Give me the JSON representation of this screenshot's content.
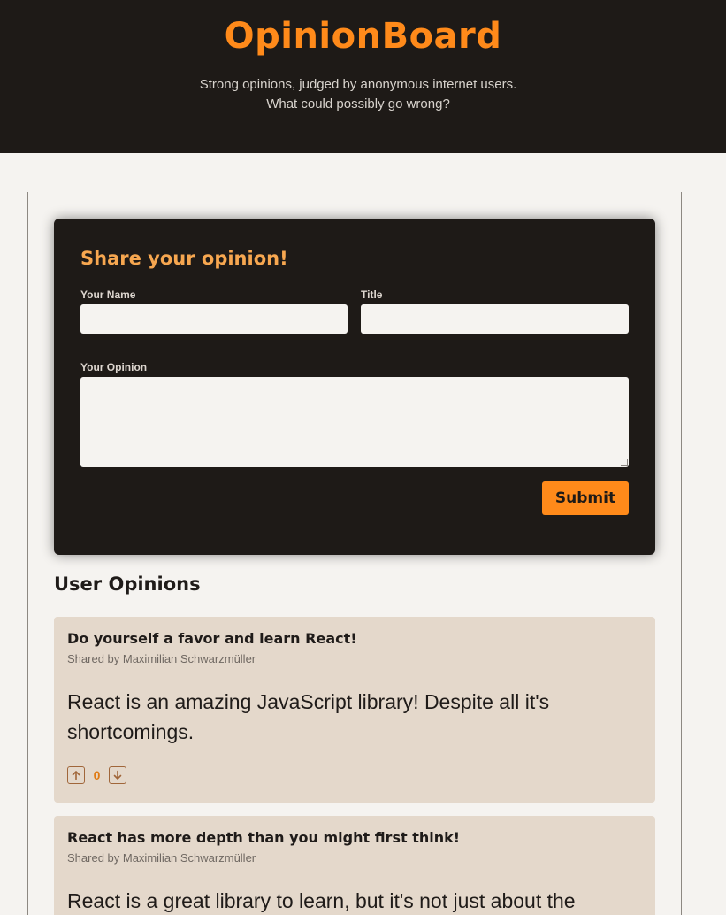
{
  "header": {
    "brand": "OpinionBoard",
    "tagline": "Strong opinions, judged by anonymous internet users. What could possibly go wrong?"
  },
  "form": {
    "heading": "Share your opinion!",
    "name_label": "Your Name",
    "name_value": "",
    "title_label": "Title",
    "title_value": "",
    "opinion_label": "Your Opinion",
    "opinion_value": "",
    "submit_label": "Submit"
  },
  "opinions_section": {
    "title": "User Opinions",
    "items": [
      {
        "title": "Do yourself a favor and learn React!",
        "author": "Shared by Maximilian Schwarzmüller",
        "body": "React is an amazing JavaScript library! Despite all it's shortcomings.",
        "votes": "0",
        "upvote_icon": "arrow-up-box-icon",
        "downvote_icon": "arrow-down-box-icon"
      },
      {
        "title": "React has more depth than you might first think!",
        "author": "Shared by Maximilian Schwarzmüller",
        "body": "React is a great library to learn, but it's not just about the"
      }
    ]
  },
  "colors": {
    "header_bg": "#1e1a17",
    "accent": "#ff8a1a",
    "form_heading": "#f7a750",
    "page_bg": "#f5f3f0",
    "card_bg": "#e4d8cb",
    "vote_count": "#e07b14"
  }
}
